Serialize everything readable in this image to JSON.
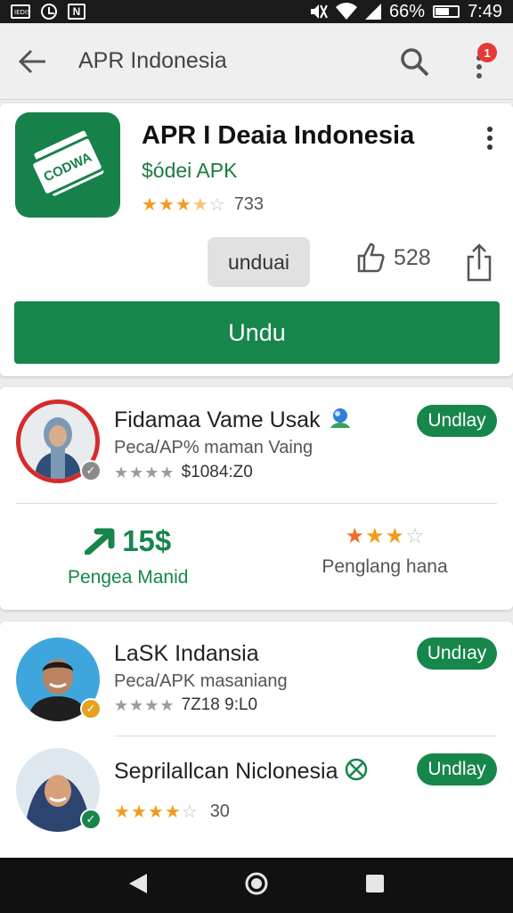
{
  "status_bar": {
    "battery": "66%",
    "time": "7:49",
    "mini_label": "IEDIS"
  },
  "app_bar": {
    "title": "APR Indonesia",
    "badge": "1"
  },
  "hero": {
    "title": "APR I Deaia Indonesia",
    "subtitle": "$ódei APK",
    "rating": 3.5,
    "rating_count": "733",
    "secondary_button": "unduai",
    "likes": "528",
    "primary_button": "Undu"
  },
  "item1": {
    "title": "Fidamaa Vame Usak",
    "subtitle": "Peca/AP% maman Vaing",
    "rating": 4,
    "price": "$1084:Z0",
    "button": "Undlay",
    "stat_left_value": "15$",
    "stat_left_label": "Pengea Manid",
    "stat_right_rating": 3,
    "stat_right_label": "Penglang hana"
  },
  "item2": {
    "title": "LaSK Indansia",
    "subtitle": "Peca/APK masaniang",
    "rating": 4,
    "meta": "7Z18 9:L0",
    "button": "Undıay"
  },
  "item3": {
    "title": "Seprilallcan Niclonesia",
    "rating": 4.5,
    "rating_count": "30",
    "button": "Undlay"
  },
  "colors": {
    "primary_green": "#17864b",
    "star": "#f29b1d",
    "badge_red": "#e53935"
  },
  "icons": [
    "back-arrow-icon",
    "search-icon",
    "more-vert-icon",
    "thumb-up-icon",
    "share-icon",
    "verified-icon",
    "trend-up-icon",
    "nav-back-icon",
    "nav-home-icon",
    "nav-recents-icon"
  ]
}
